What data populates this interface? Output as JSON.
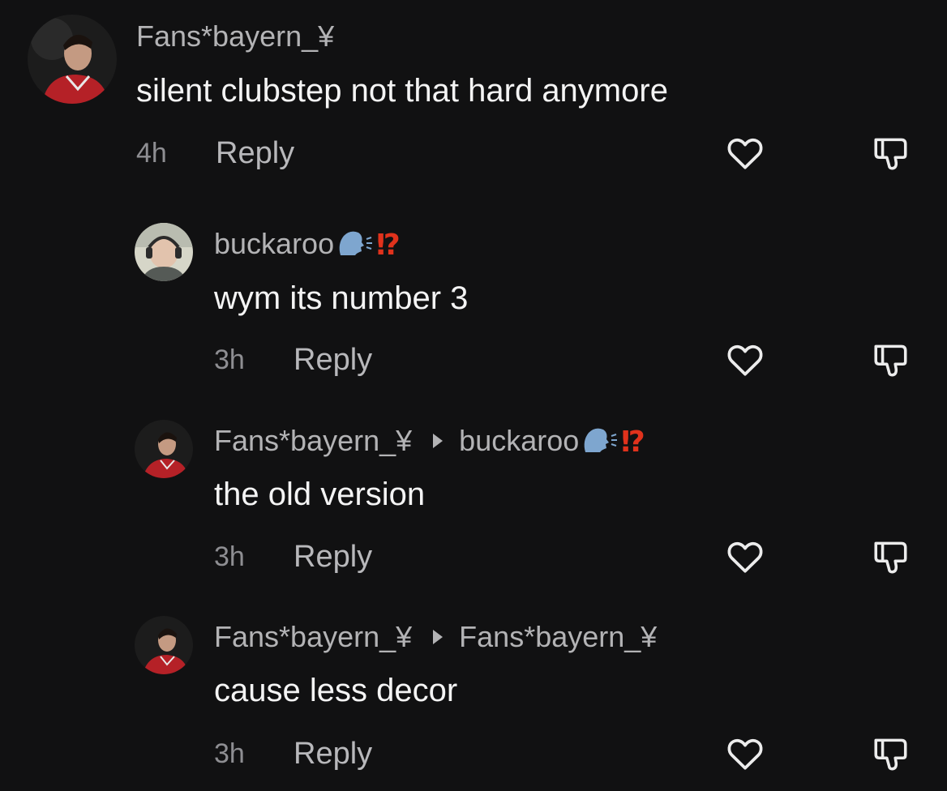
{
  "comments": [
    {
      "user": "Fans*bayern_¥",
      "reply_to": "",
      "text": "silent clubstep not that hard anymore",
      "time": "4h",
      "reply_label": "Reply"
    },
    {
      "user": "buckaroo",
      "reply_to": "",
      "text": "wym its number 3",
      "time": "3h",
      "reply_label": "Reply"
    },
    {
      "user": "Fans*bayern_¥",
      "reply_to": "buckaroo",
      "text": "the old version",
      "time": "3h",
      "reply_label": "Reply"
    },
    {
      "user": "Fans*bayern_¥",
      "reply_to": "Fans*bayern_¥",
      "text": "cause less decor",
      "time": "3h",
      "reply_label": "Reply"
    }
  ],
  "icons": {
    "like": "heart-icon",
    "dislike": "thumbs-down-icon",
    "reply_arrow": "play-arrow-icon",
    "speaking_head": "speaking-head-emoji",
    "interrobang": "interrobang-emoji"
  },
  "colors": {
    "background": "#111112",
    "username": "#b3b3b5",
    "text": "#f4f4f4",
    "meta": "#8e8e92",
    "interrobang": "#e0321c"
  }
}
